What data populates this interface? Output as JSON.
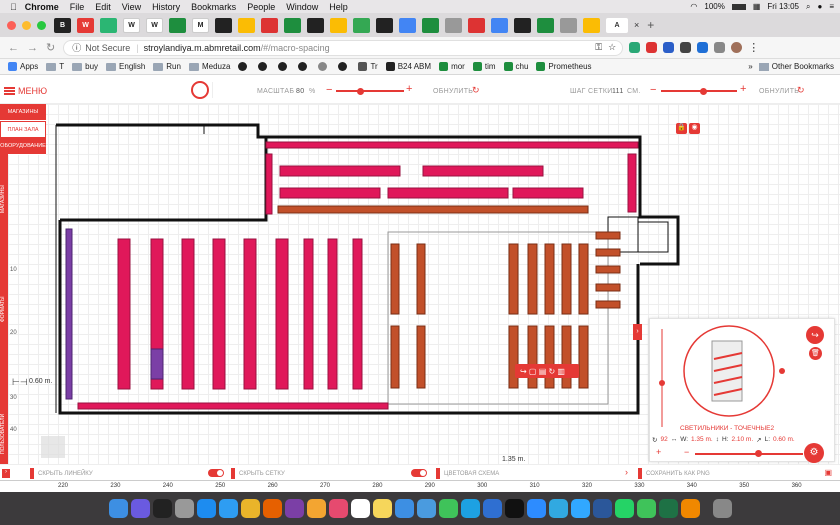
{
  "menubar": {
    "app": "Chrome",
    "items": [
      "File",
      "Edit",
      "View",
      "History",
      "Bookmarks",
      "People",
      "Window",
      "Help"
    ],
    "battery": "100%",
    "clock": "Fri 13:05"
  },
  "tabs": {
    "labels": [
      "B",
      "W",
      "",
      "W",
      "W",
      "",
      "M",
      "",
      "",
      "",
      "",
      "",
      "",
      "",
      "",
      "",
      "",
      "",
      "",
      "",
      "",
      "",
      "",
      "",
      "",
      "",
      "",
      "",
      "",
      "",
      "",
      "",
      ""
    ],
    "active_label": "A",
    "new_tab": "+"
  },
  "address": {
    "not_secure": "Not Secure",
    "host": "stroylandiya.m.abmretail.com",
    "path": "/#/macro-spacing"
  },
  "bookmarks": {
    "items": [
      "Apps",
      "T",
      "buy",
      "English",
      "Run",
      "Meduza",
      "",
      "",
      "",
      "",
      "",
      "",
      "Tr",
      "B24 ABM",
      "mor",
      "tim",
      "chu",
      "Prometheus"
    ],
    "other": "Other Bookmarks"
  },
  "app": {
    "menu_label": "МЕНЮ",
    "scale_label": "МАСШТАБ",
    "scale_value": "80",
    "scale_unit": "%",
    "reset1": "ОБНУЛИТЬ",
    "grid_label": "ШАГ СЕТКИ",
    "grid_value": "111",
    "grid_unit": "СМ.",
    "reset2": "ОБНУЛИТЬ",
    "scale_level": 0.35,
    "grid_level": 0.55
  },
  "left_panel": {
    "items": [
      "МАГАЗИНЫ",
      "ПЛАН ЗАЛА",
      "ОБОРУДОВАНИЕ"
    ]
  },
  "vertical_tabs": [
    "МАГАЗИНЫ",
    "ФОРМАТЫ",
    "ПОЛЬЗОВАТЕЛИ"
  ],
  "ruler_left": [
    "10",
    "20",
    "30",
    "40"
  ],
  "measure_left": "0.60 m.",
  "measure_bottom": "1.35 m.",
  "lamp_card": {
    "title": "СВЕТИЛЬНИКИ - ТОЧЕЧНЫЕ2",
    "rotation": "92",
    "width_label": "W:",
    "width": "1.35 m.",
    "height_label": "H:",
    "height": "2.10 m.",
    "length_label": "L:",
    "length": "0.60 m."
  },
  "bottom_bar": {
    "hide_ruler": "СКРЫТЬ ЛИНЕЙКУ",
    "hide_grid": "СКРЫТЬ СЕТКУ",
    "color_scheme": "ЦВЕТОВАЯ СХЕМА",
    "save_png": "СОХРАНИТЬ КАК PNG"
  },
  "ruler_bottom": [
    "220",
    "230",
    "240",
    "250",
    "260",
    "270",
    "280",
    "290",
    "300",
    "310",
    "320",
    "330",
    "340",
    "350",
    "360"
  ],
  "colors": {
    "accent": "#e53935",
    "shelf_pink": "#e0185a",
    "shelf_orange": "#c2502a",
    "shelf_purple": "#7b3fa6"
  },
  "dock": [
    "finder",
    "siri",
    "activity",
    "launchpad",
    "app-store",
    "safari",
    "chrome",
    "firefox",
    "tor",
    "photos",
    "itunes",
    "calendar",
    "notes",
    "mail",
    "preview",
    "messages",
    "skype",
    "teamviewer",
    "terminal",
    "zoom",
    "telegram",
    "photoshop",
    "word",
    "whatsapp",
    "facetime",
    "excel",
    "vlc",
    "trash"
  ]
}
